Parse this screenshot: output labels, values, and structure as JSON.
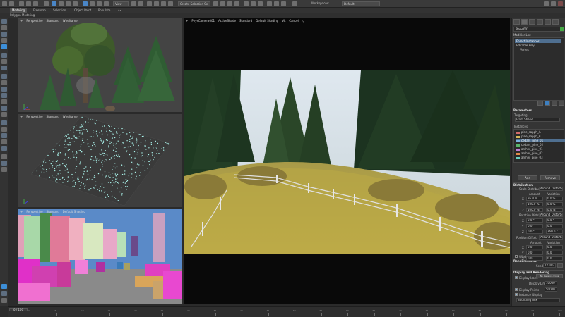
{
  "toolbar": {
    "workspace_label": "Workspaces:",
    "workspace_value": "Default",
    "selection_set": "Create Selection Se"
  },
  "ribbon": {
    "tabs": [
      "Modeling",
      "Freeform",
      "Selection",
      "Object Paint",
      "Populate"
    ],
    "active_tab": "Modeling",
    "sub_label": "Polygon Modeling"
  },
  "viewports": {
    "top_left": {
      "label_parts": [
        "+",
        "Perspective",
        "Standard",
        "Wireframe"
      ]
    },
    "mid_left": {
      "label_parts": [
        "+",
        "Perspective",
        "Standard",
        "Wireframe"
      ]
    },
    "bottom_left": {
      "label_parts": [
        "+",
        "Perspective",
        "Standard",
        "Default Shading"
      ]
    },
    "main": {
      "label_parts": [
        "+",
        "PhysCamera001",
        "ActiveShade",
        "Standard",
        "Default Shading",
        "VL",
        "Cancel",
        "▽"
      ]
    }
  },
  "right_panel": {
    "object_name": "Plane001",
    "modifier_list_label": "Modifier List",
    "stack": [
      "Forest Instances",
      "Editable Poly",
      "Vertex"
    ],
    "stack_selected": 0,
    "parameters_heading": "Parameters",
    "targeting_label": "Targeting",
    "targeting_value": "From Shape",
    "instances_label": "Instances",
    "instances": [
      {
        "name": "pine_sapph_A",
        "color": "#d26a6a"
      },
      {
        "name": "pine_sapph_B",
        "color": "#d6b85a"
      },
      {
        "name": "cedars_pine_01",
        "color": "#7ab0e0"
      },
      {
        "name": "cedars_pine_02",
        "color": "#5ab36a"
      },
      {
        "name": "archer_pine_01",
        "color": "#c07ad6"
      },
      {
        "name": "archer_pine_02",
        "color": "#e08a4a"
      },
      {
        "name": "archer_pine_03",
        "color": "#6ad0c0"
      }
    ],
    "instances_selected": 2,
    "btn_add": "Add",
    "btn_remove": "Remove",
    "distribution_heading": "Distribution",
    "scale_label": "Scale Distribution",
    "scale_value": "Around Distortion",
    "amount_label": "Amount",
    "variation_label": "Variation",
    "rows": [
      {
        "axis": "X",
        "amount": "95.0 %",
        "variation": "0.0 %"
      },
      {
        "axis": "Y",
        "amount": "100.0 %",
        "variation": "0.0 %"
      },
      {
        "axis": "Z",
        "amount": "100.0 %",
        "variation": "0.0 %"
      }
    ],
    "rotation_label": "Rotation Distrib",
    "rotation_value": "Around Distortion",
    "rot_rows": [
      {
        "axis": "X",
        "amount": "0.0 °",
        "variation": "0.0 °"
      },
      {
        "axis": "Y",
        "amount": "0.0 °",
        "variation": "0.0 °"
      },
      {
        "axis": "Z",
        "amount": "0.0 °",
        "variation": "360.0 °"
      }
    ],
    "position_label": "Position Offset",
    "position_value": "Around Distortion",
    "pos_rows": [
      {
        "axis": "X",
        "amount": "0.0",
        "variation": "0.0"
      },
      {
        "axis": "Y",
        "amount": "0.0",
        "variation": "0.0"
      },
      {
        "axis": "Z",
        "amount": "0.0",
        "variation": "0.0"
      }
    ],
    "pos_col_amount": "Amount",
    "pos_col_variation": "Variation",
    "wind_label": "Wind",
    "randomization_heading": "Randomization",
    "seed_label": "Seed",
    "seed_value": "12345",
    "display_heading": "Display and Rendering",
    "display_icons_label": "Display Icons",
    "display_icons_btn": "No Instance Icons",
    "display_limit_label": "Display Limit",
    "display_limit_value": "10000",
    "display_points_label": "Display Points",
    "display_points_value": "50000",
    "instance_display_label": "Instance Display",
    "bounding_value": "Bounding Box"
  },
  "timeline": {
    "frame_counter": "0 / 100",
    "ticks": [
      "0",
      "5",
      "10",
      "15",
      "20",
      "25",
      "30",
      "35",
      "40",
      "45",
      "50",
      "55",
      "60",
      "65",
      "70",
      "75",
      "80",
      "85",
      "90",
      "95",
      "100"
    ]
  },
  "colors": {
    "accent_blue": "#3d8fd8",
    "viewport_border_active": "#d4b84a",
    "render_border": "#b8b230"
  }
}
